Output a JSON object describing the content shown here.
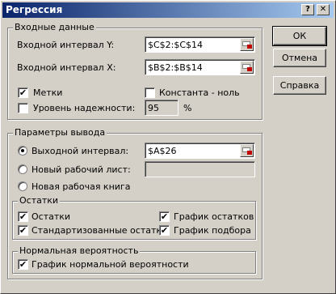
{
  "window": {
    "title": "Регрессия",
    "help_glyph": "?",
    "close_glyph": "✕"
  },
  "input": {
    "group_title": "Входные данные",
    "y_label": "Входной интервал Y:",
    "y_value": "$C$2:$C$14",
    "x_label": "Входной интервал X:",
    "x_value": "$B$2:$B$14",
    "labels_label": "Метки",
    "labels_checked": true,
    "constant_zero_label": "Константа - ноль",
    "constant_zero_checked": false,
    "confidence_label": "Уровень надежности:",
    "confidence_checked": false,
    "confidence_value": "95",
    "percent_sign": "%"
  },
  "output": {
    "group_title": "Параметры вывода",
    "output_range_label": "Выходной интервал:",
    "output_range_value": "$A$26",
    "output_range_selected": true,
    "new_sheet_label": "Новый рабочий лист:",
    "new_sheet_value": "",
    "new_workbook_label": "Новая рабочая книга"
  },
  "residuals": {
    "group_title": "Остатки",
    "residuals_label": "Остатки",
    "standardized_label": "Стандартизованные остатки",
    "residual_plot_label": "График остатков",
    "fit_plot_label": "График подбора"
  },
  "normal": {
    "group_title": "Нормальная вероятность",
    "normal_plot_label": "График нормальной вероятности"
  },
  "buttons": {
    "ok": "ОК",
    "cancel": "Отмена",
    "help": "Справка"
  },
  "check_mark": "✔"
}
